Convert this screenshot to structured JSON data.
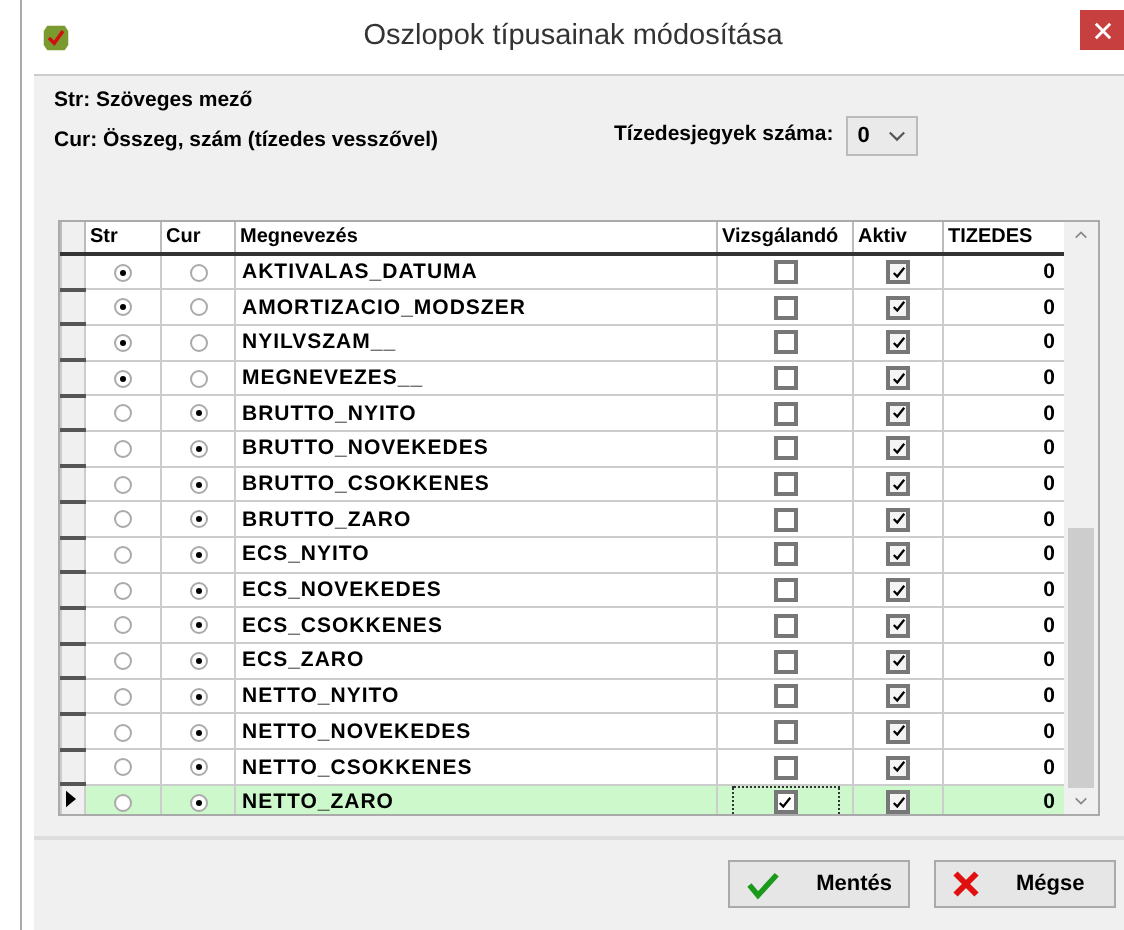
{
  "window": {
    "title": "Oszlopok típusainak módosítása"
  },
  "legend": [
    "Str: Szöveges mező",
    "Cur: Összeg, szám (tízedes vesszővel)"
  ],
  "decimals": {
    "label": "Tízedesjegyek száma:",
    "value": "0"
  },
  "table": {
    "columns": [
      "Str",
      "Cur",
      "Megnevezés",
      "Vizsgálandó",
      "Aktiv",
      "TIZEDES"
    ],
    "rows": [
      {
        "str": true,
        "cur": false,
        "name": "AKTIVALAS_DATUMA",
        "vizsgalando": false,
        "aktiv": true,
        "tizedes": "0",
        "selected": false
      },
      {
        "str": true,
        "cur": false,
        "name": "AMORTIZACIO_MODSZER",
        "vizsgalando": false,
        "aktiv": true,
        "tizedes": "0",
        "selected": false
      },
      {
        "str": true,
        "cur": false,
        "name": "NYILVSZAM__",
        "vizsgalando": false,
        "aktiv": true,
        "tizedes": "0",
        "selected": false
      },
      {
        "str": true,
        "cur": false,
        "name": "MEGNEVEZES__",
        "vizsgalando": false,
        "aktiv": true,
        "tizedes": "0",
        "selected": false
      },
      {
        "str": false,
        "cur": true,
        "name": "BRUTTO_NYITO",
        "vizsgalando": false,
        "aktiv": true,
        "tizedes": "0",
        "selected": false
      },
      {
        "str": false,
        "cur": true,
        "name": "BRUTTO_NOVEKEDES",
        "vizsgalando": false,
        "aktiv": true,
        "tizedes": "0",
        "selected": false
      },
      {
        "str": false,
        "cur": true,
        "name": "BRUTTO_CSOKKENES",
        "vizsgalando": false,
        "aktiv": true,
        "tizedes": "0",
        "selected": false
      },
      {
        "str": false,
        "cur": true,
        "name": "BRUTTO_ZARO",
        "vizsgalando": false,
        "aktiv": true,
        "tizedes": "0",
        "selected": false
      },
      {
        "str": false,
        "cur": true,
        "name": "ECS_NYITO",
        "vizsgalando": false,
        "aktiv": true,
        "tizedes": "0",
        "selected": false
      },
      {
        "str": false,
        "cur": true,
        "name": "ECS_NOVEKEDES",
        "vizsgalando": false,
        "aktiv": true,
        "tizedes": "0",
        "selected": false
      },
      {
        "str": false,
        "cur": true,
        "name": "ECS_CSOKKENES",
        "vizsgalando": false,
        "aktiv": true,
        "tizedes": "0",
        "selected": false
      },
      {
        "str": false,
        "cur": true,
        "name": "ECS_ZARO",
        "vizsgalando": false,
        "aktiv": true,
        "tizedes": "0",
        "selected": false
      },
      {
        "str": false,
        "cur": true,
        "name": "NETTO_NYITO",
        "vizsgalando": false,
        "aktiv": true,
        "tizedes": "0",
        "selected": false
      },
      {
        "str": false,
        "cur": true,
        "name": "NETTO_NOVEKEDES",
        "vizsgalando": false,
        "aktiv": true,
        "tizedes": "0",
        "selected": false
      },
      {
        "str": false,
        "cur": true,
        "name": "NETTO_CSOKKENES",
        "vizsgalando": false,
        "aktiv": true,
        "tizedes": "0",
        "selected": false
      },
      {
        "str": false,
        "cur": true,
        "name": "NETTO_ZARO",
        "vizsgalando": true,
        "aktiv": true,
        "tizedes": "0",
        "selected": true
      }
    ]
  },
  "buttons": [
    "Mentés",
    "Mégse"
  ]
}
